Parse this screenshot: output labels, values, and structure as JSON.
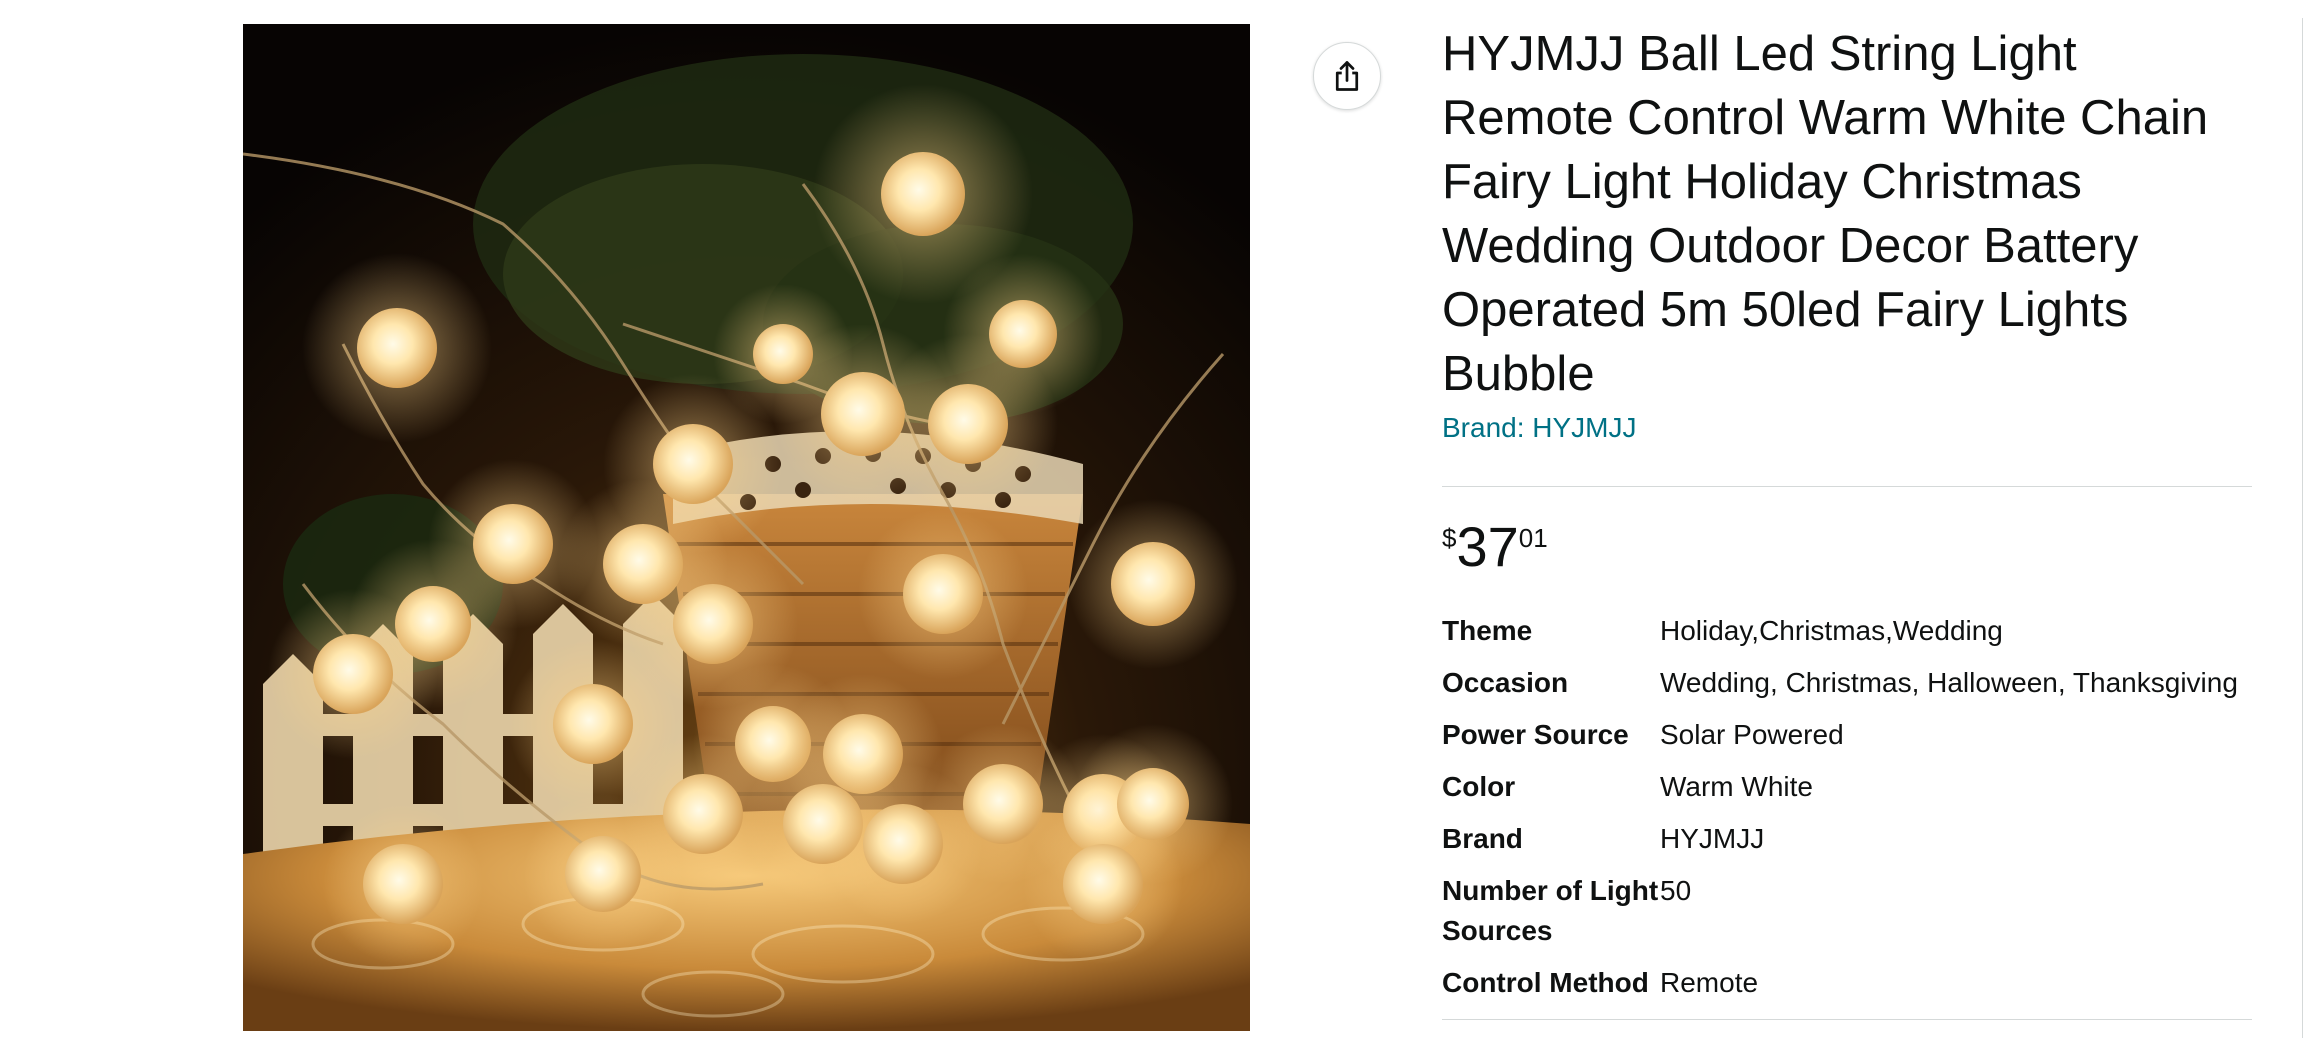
{
  "product": {
    "title": "HYJMJJ Ball Led String Light Remote Control Warm White Chain Fairy Light Holiday Christmas Wedding Outdoor Decor Battery Operated 5m 50led Fairy Lights Bubble",
    "brand_link": "Brand: HYJMJJ",
    "image_alt": "Warm white globe fairy lights draped over a basket and a white picket fence"
  },
  "price": {
    "symbol": "$",
    "whole": "37",
    "fraction": "01"
  },
  "specs": [
    {
      "label": "Theme",
      "value": "Holiday,Christmas,Wedding"
    },
    {
      "label": "Occasion",
      "value": "Wedding, Christmas, Halloween, Thanksgiving"
    },
    {
      "label": "Power Source",
      "value": "Solar Powered"
    },
    {
      "label": "Color",
      "value": "Warm White"
    },
    {
      "label": "Brand",
      "value": "HYJMJJ"
    },
    {
      "label": "Number of Light Sources",
      "value": "50"
    },
    {
      "label": "Control Method",
      "value": "Remote"
    }
  ],
  "icons": {
    "share": "share-icon"
  },
  "colors": {
    "link": "#007185",
    "text": "#0f1111",
    "divider": "#d5d9d9"
  }
}
